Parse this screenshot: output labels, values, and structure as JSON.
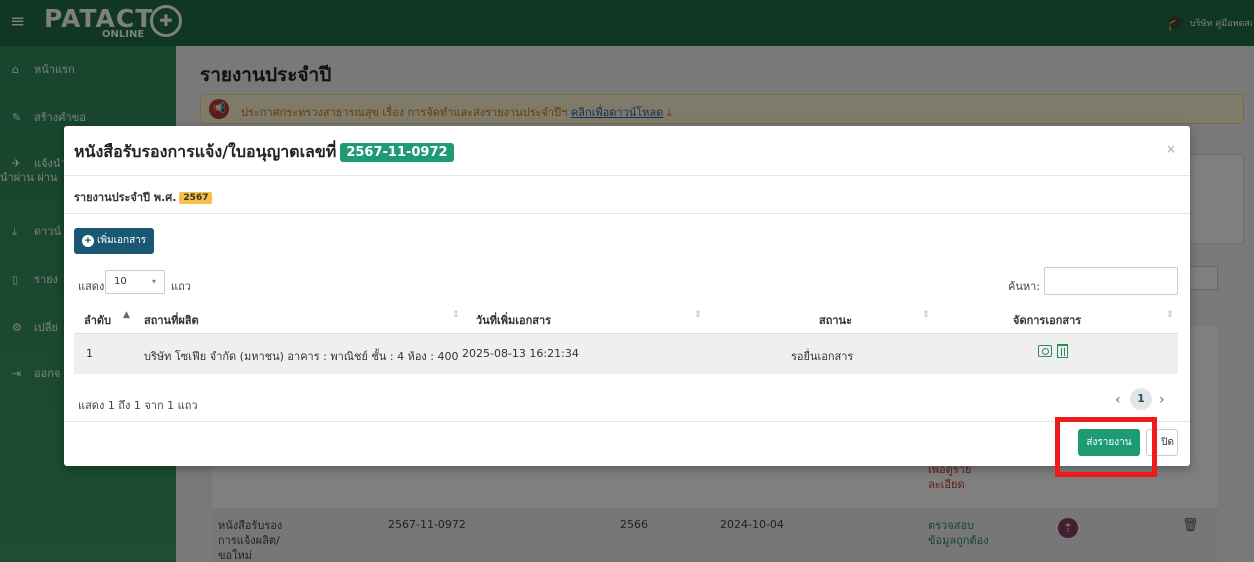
{
  "app": {
    "logo": "PATACT",
    "logo_sub": "ONLINE",
    "user_company": "บริษัท คู่มือทดสอบระบบ จำกัด"
  },
  "sidebar": {
    "items": [
      {
        "label": "หน้าแรก",
        "icon": "home-icon"
      },
      {
        "label": "สร้างคำขอ",
        "icon": "pencil-icon"
      },
      {
        "label": "แจ้งนำผ่าน",
        "line2": "นำผ่าน ผ่าน",
        "icon": "plane-icon"
      },
      {
        "label": "ดาวน์",
        "icon": "download-icon"
      },
      {
        "label": "รายง",
        "icon": "file-icon"
      },
      {
        "label": "เปลี่ย",
        "icon": "gear-icon"
      },
      {
        "label": "ออกจ",
        "icon": "logout-icon"
      }
    ]
  },
  "page": {
    "title": "รายงานประจำปี",
    "notice_text": "ประกาศกระทรวงสาธารณสุข เรื่อง การจัดทำและส่งรายงานประจำปีฯ",
    "notice_link": "คลิกเพื่อดาวน์โหลด"
  },
  "background_table": {
    "partial_status": "เพื่อดูราย\nละเอียด",
    "row": {
      "type": "หนังสือรับรอง\nการแจ้งผลิต/\nขอใหม่",
      "license": "2567-11-0972",
      "year": "2566",
      "date": "2024-10-04",
      "status": "ตรวจสอบ\nข้อมูลถูกต้อง"
    }
  },
  "modal": {
    "title": "หนังสือรับรองการแจ้ง/ใบอนุญาตเลขที่",
    "license_no": "2567-11-0972",
    "close": "×",
    "subheader": "รายงานประจำปี พ.ศ.",
    "year": "2567",
    "add_doc_label": "เพิ่มเอกสาร",
    "show_label": "แสดง",
    "page_length": "10",
    "rows_label": "แถว",
    "search_label": "ค้นหา:",
    "search_value": "",
    "columns": [
      "ลำดับ",
      "สถานที่ผลิต",
      "วันที่เพิ่มเอกสาร",
      "สถานะ",
      "จัดการเอกสาร"
    ],
    "rows": [
      {
        "index": "1",
        "place": "บริษัท โซเฟีย จำกัด (มหาชน) อาคาร : พาณิชย์ ชั้น : 4 ห้อง : 400",
        "date_added": "2025-08-13 16:21:34",
        "status": "รอยื่นเอกสาร"
      }
    ],
    "info": "แสดง 1 ถึง 1 จาก 1 แถว",
    "current_page": "1",
    "prev": "‹",
    "next": "›",
    "submit_label": "ส่งรายงาน",
    "close_label": "ปิด"
  },
  "colors": {
    "header_green": "#1f6e49",
    "accent_teal": "#1e9b74",
    "primary_blue": "#1a5773",
    "highlight_red": "#f01a1a"
  }
}
